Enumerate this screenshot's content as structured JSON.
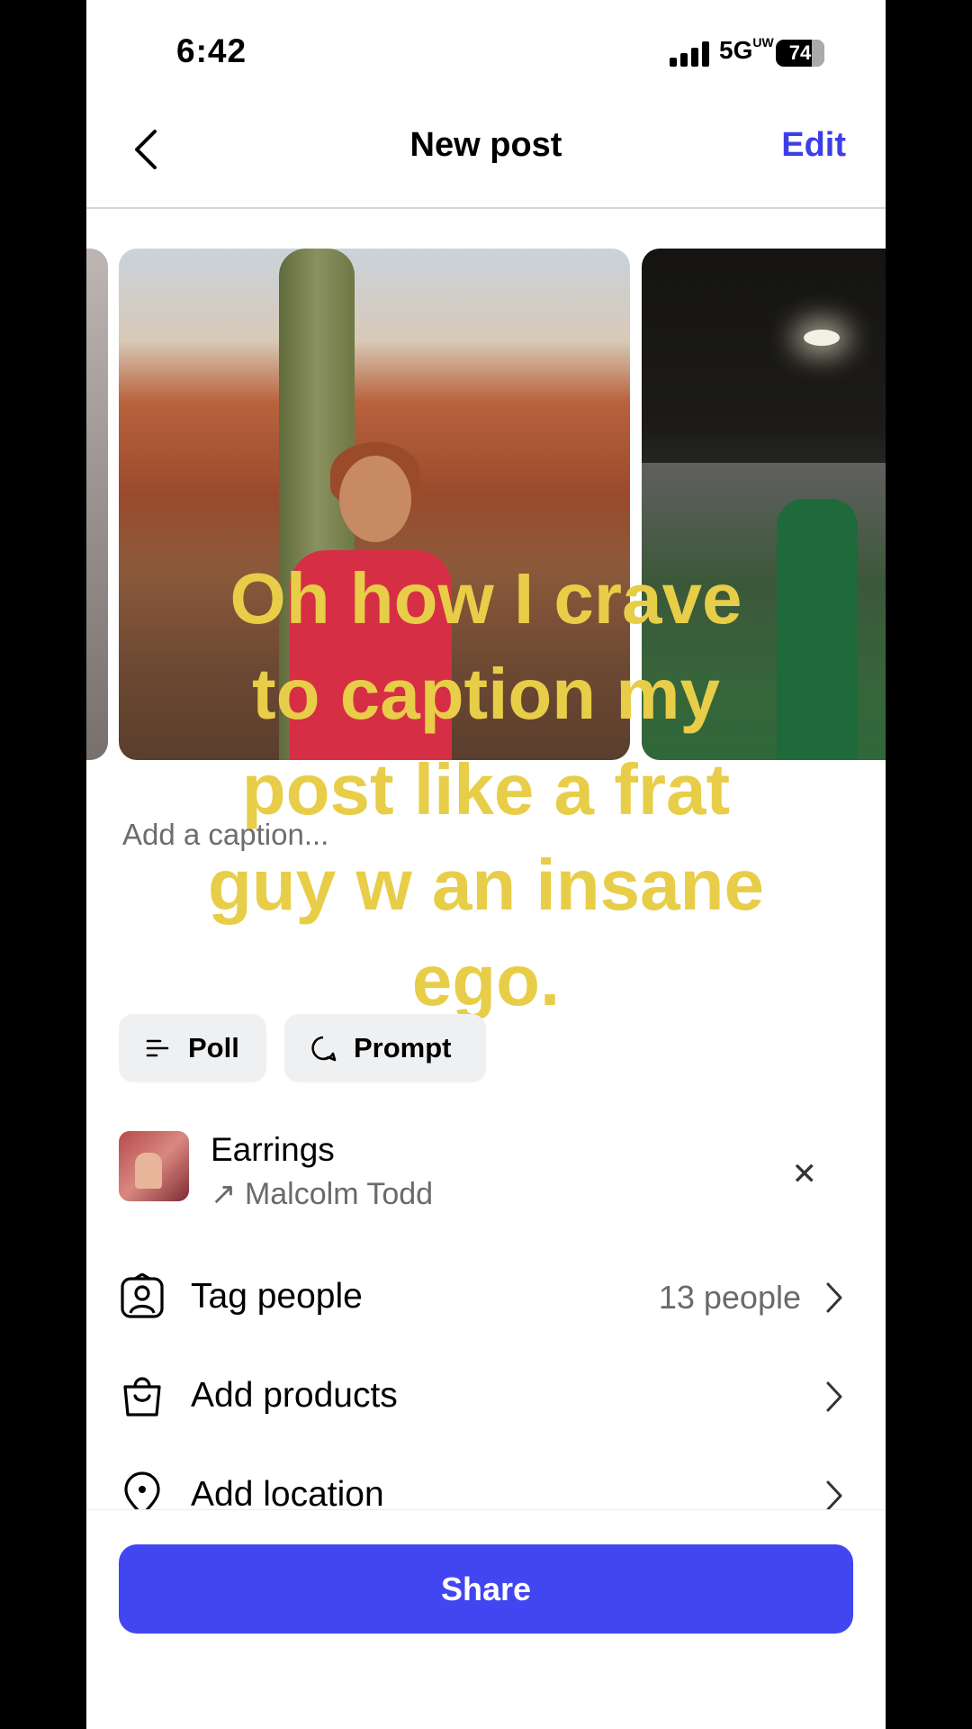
{
  "status_bar": {
    "time": "6:42",
    "network": "5G",
    "network_sup": "UW",
    "battery": "74"
  },
  "header": {
    "title": "New post",
    "edit_label": "Edit"
  },
  "caption": {
    "placeholder": "Add a caption..."
  },
  "overlay_text": "Oh how I crave\nto caption my\npost like a frat\nguy w an insane\nego.",
  "chips": {
    "poll_label": "Poll",
    "prompt_label": "Prompt"
  },
  "music": {
    "song": "Earrings",
    "artist_arrow": "↗",
    "artist": "Malcolm Todd"
  },
  "rows": {
    "tag_people": {
      "label": "Tag people",
      "value": "13 people"
    },
    "add_products": {
      "label": "Add products"
    },
    "add_location": {
      "label": "Add location"
    }
  },
  "share_label": "Share",
  "colors": {
    "accent": "#4146f0",
    "edit": "#3b3fe6",
    "overlay_text": "#e8cd48"
  }
}
